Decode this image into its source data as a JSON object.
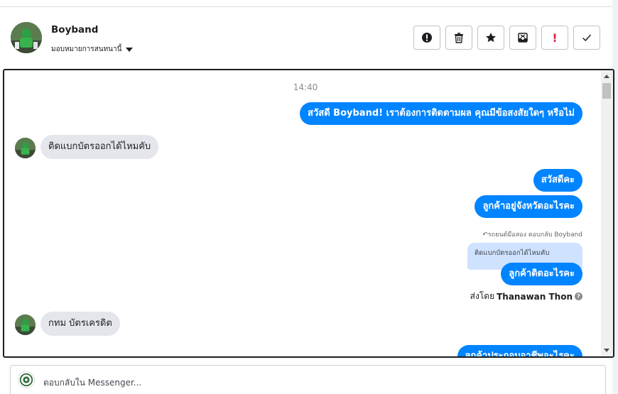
{
  "contact": {
    "name": "Boyband",
    "assign_label": "มอบหมายการสนทนานี้"
  },
  "toolbar": {
    "buttons": [
      {
        "name": "spam-icon",
        "symbol": "!"
      },
      {
        "name": "trash-icon",
        "symbol": "🗑"
      },
      {
        "name": "star-icon",
        "symbol": "★"
      },
      {
        "name": "archive-icon",
        "symbol": "⊠"
      },
      {
        "name": "important-icon",
        "symbol": "!"
      },
      {
        "name": "check-icon",
        "symbol": "✓"
      }
    ]
  },
  "conversation": {
    "timestamp": "14:40",
    "messages": [
      {
        "side": "out",
        "text": "สวัสดี Boyband! เราต้องการติดตามผล คุณมีข้อสงสัยใดๆ หรือไม่"
      },
      {
        "side": "in",
        "text": "ติดแบกบัตรออกได้ไหมคับ"
      },
      {
        "side": "out",
        "text": "สวัสดีคะ"
      },
      {
        "side": "out",
        "text": "ลูกค้าอยู่จังหวัดอะไรคะ"
      },
      {
        "side": "out",
        "text": "ลูกค้าติดอะไรคะ"
      },
      {
        "side": "in",
        "text": "กทม บัตรเครดิต"
      },
      {
        "side": "out",
        "text": "ลูกค้าประกอบอาชีพอะไรคะ"
      }
    ],
    "reply_note": "รถยนต์มือสอง ตอบกลับ Boyband",
    "quoted_text": "ติดแบกบัตรออกได้ไหมคับ",
    "sent_by_label": "ส่งโดย",
    "sent_by_name": "Thanawan Thon"
  },
  "reply_box": {
    "placeholder": "ตอบกลับใน Messenger..."
  },
  "colors": {
    "accent": "#0084ff",
    "incoming_bubble": "#e4e6eb",
    "quoted_bubble": "#cfe2ff",
    "danger": "#e41e3f"
  }
}
